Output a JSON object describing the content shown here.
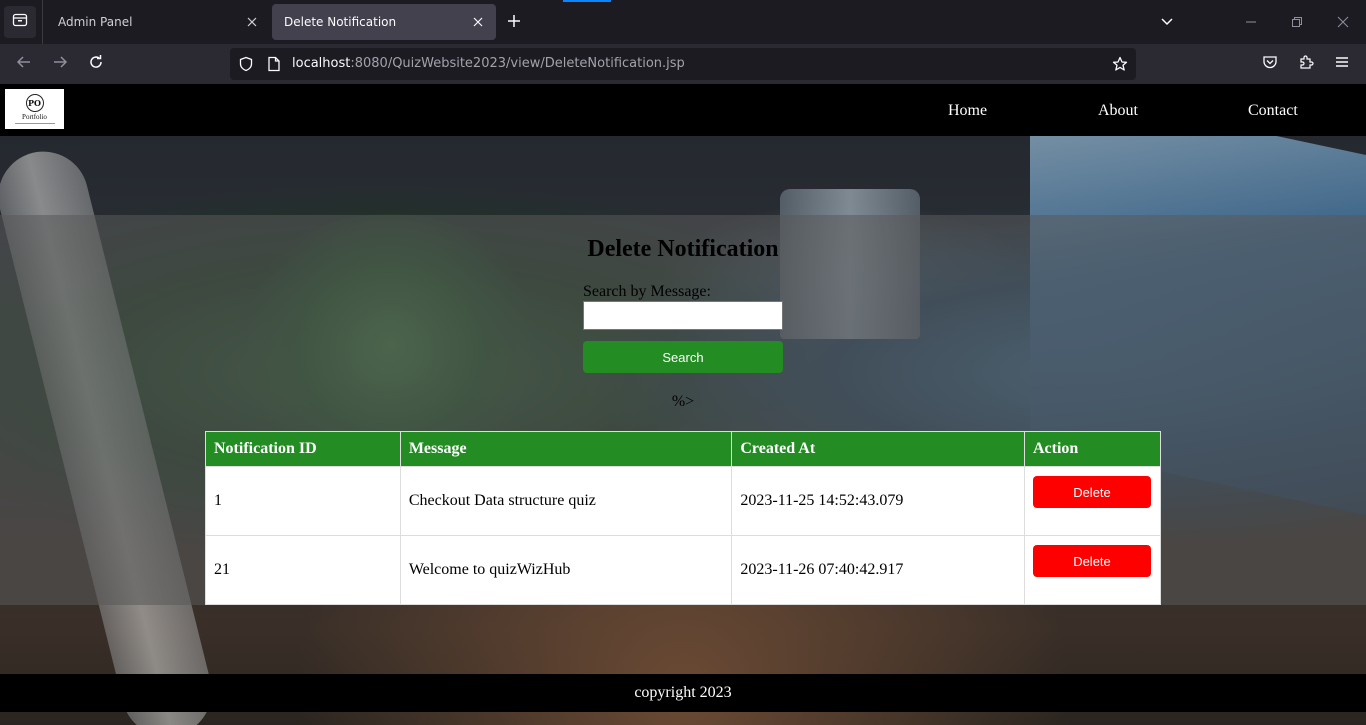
{
  "browser": {
    "tabs": [
      {
        "title": "Admin Panel",
        "active": false
      },
      {
        "title": "Delete Notification",
        "active": true
      }
    ],
    "url": {
      "host": "localhost",
      "path": ":8080/QuizWebsite2023/view/DeleteNotification.jsp"
    }
  },
  "site": {
    "logo_text": "Portfolio",
    "logo_mark": "PO",
    "nav": {
      "home": "Home",
      "about": "About",
      "contact": "Contact"
    }
  },
  "main": {
    "title": "Delete Notification",
    "search_label": "Search by Message:",
    "search_value": "",
    "search_button": "Search",
    "stray_text": "%>"
  },
  "table": {
    "headers": [
      "Notification ID",
      "Message",
      "Created At",
      "Action"
    ],
    "rows": [
      {
        "id": "1",
        "message": "Checkout Data structure quiz",
        "created_at": "2023-11-25 14:52:43.079",
        "action": "Delete"
      },
      {
        "id": "21",
        "message": "Welcome to quizWizHub",
        "created_at": "2023-11-26 07:40:42.917",
        "action": "Delete"
      }
    ]
  },
  "footer": {
    "text": "copyright 2023"
  },
  "colors": {
    "accent_green": "#238c23",
    "delete_red": "#ff0000",
    "header_black": "#000000"
  }
}
